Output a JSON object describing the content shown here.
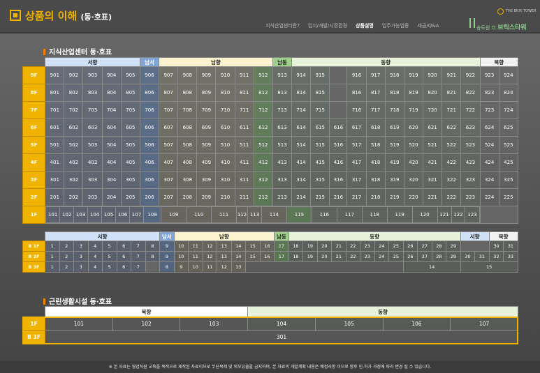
{
  "header": {
    "title": "상품의 이해",
    "subtitle": "(동·호표)",
    "nav": [
      "지식산업센터란?",
      "입지/개발/시장환경",
      "상품설명",
      "입주가능업종",
      "세금/Q&A"
    ],
    "nav_active": 2,
    "logo_top": "THE BRIX TOWER",
    "logo_prefix": "송도원 더",
    "logo_name": "브릭스타워"
  },
  "section1": {
    "title": "지식산업센터 동·호표",
    "directions": [
      "서향",
      "남서",
      "남향",
      "남동",
      "동향",
      "북향"
    ],
    "floors": [
      {
        "label": "9F",
        "units": [
          "901",
          "902",
          "903",
          "904",
          "905",
          "906",
          "907",
          "908",
          "909",
          "910",
          "911",
          "912",
          "913",
          "914",
          "915",
          "",
          "916",
          "917",
          "918",
          "919",
          "920",
          "921",
          "922",
          "923",
          "924"
        ]
      },
      {
        "label": "8F",
        "units": [
          "801",
          "802",
          "803",
          "804",
          "805",
          "806",
          "807",
          "808",
          "809",
          "810",
          "811",
          "812",
          "813",
          "814",
          "815",
          "",
          "816",
          "817",
          "818",
          "819",
          "820",
          "821",
          "822",
          "823",
          "824"
        ]
      },
      {
        "label": "7F",
        "units": [
          "701",
          "702",
          "703",
          "704",
          "705",
          "706",
          "707",
          "708",
          "709",
          "710",
          "711",
          "712",
          "713",
          "714",
          "715",
          "",
          "716",
          "717",
          "718",
          "719",
          "720",
          "721",
          "722",
          "723",
          "724"
        ]
      },
      {
        "label": "6F",
        "units": [
          "601",
          "602",
          "603",
          "604",
          "605",
          "606",
          "607",
          "608",
          "609",
          "610",
          "611",
          "612",
          "613",
          "614",
          "615",
          "616",
          "617",
          "618",
          "619",
          "620",
          "621",
          "622",
          "623",
          "624",
          "625"
        ]
      },
      {
        "label": "5F",
        "units": [
          "501",
          "502",
          "503",
          "504",
          "505",
          "506",
          "507",
          "508",
          "509",
          "510",
          "511",
          "512",
          "513",
          "514",
          "515",
          "516",
          "517",
          "518",
          "519",
          "520",
          "521",
          "522",
          "523",
          "524",
          "525"
        ]
      },
      {
        "label": "4F",
        "units": [
          "401",
          "402",
          "403",
          "404",
          "405",
          "406",
          "407",
          "408",
          "409",
          "410",
          "411",
          "412",
          "413",
          "414",
          "415",
          "416",
          "417",
          "418",
          "419",
          "420",
          "421",
          "422",
          "423",
          "424",
          "425"
        ]
      },
      {
        "label": "3F",
        "units": [
          "301",
          "302",
          "303",
          "304",
          "305",
          "306",
          "307",
          "308",
          "309",
          "310",
          "311",
          "312",
          "313",
          "314",
          "315",
          "316",
          "317",
          "318",
          "319",
          "320",
          "321",
          "322",
          "323",
          "324",
          "325"
        ]
      },
      {
        "label": "2F",
        "units": [
          "201",
          "202",
          "203",
          "204",
          "205",
          "206",
          "207",
          "208",
          "209",
          "210",
          "211",
          "212",
          "213",
          "214",
          "215",
          "216",
          "217",
          "218",
          "219",
          "220",
          "221",
          "222",
          "223",
          "224",
          "225"
        ]
      }
    ],
    "floor1": {
      "label": "1F",
      "units": [
        "101",
        "102",
        "103",
        "104",
        "105",
        "106",
        "107",
        "108",
        "109",
        "110",
        "111",
        "112",
        "113",
        "114",
        "115",
        "116",
        "117",
        "118",
        "119",
        "120",
        "121",
        "122",
        "123"
      ]
    }
  },
  "basement": {
    "directions": [
      "서향",
      "남서",
      "남향",
      "남동",
      "동향",
      "서향",
      "북향"
    ],
    "rows": [
      {
        "label": "B 1F",
        "units": [
          "1",
          "2",
          "3",
          "4",
          "5",
          "6",
          "7",
          "8",
          "9",
          "10",
          "11",
          "12",
          "13",
          "14",
          "15",
          "16",
          "17",
          "18",
          "19",
          "20",
          "21",
          "22",
          "23",
          "24",
          "25",
          "26",
          "27",
          "28",
          "29",
          "",
          "30",
          "31"
        ]
      },
      {
        "label": "B 2F",
        "units": [
          "1",
          "2",
          "3",
          "4",
          "5",
          "6",
          "7",
          "8",
          "9",
          "10",
          "11",
          "12",
          "13",
          "14",
          "15",
          "16",
          "17",
          "18",
          "19",
          "20",
          "21",
          "22",
          "23",
          "24",
          "25",
          "26",
          "27",
          "28",
          "29",
          "30",
          "31",
          "32",
          "33"
        ]
      },
      {
        "label": "B 3F",
        "units": [
          "1",
          "2",
          "3",
          "4",
          "5",
          "6",
          "7",
          "8",
          "9",
          "10",
          "11",
          "12",
          "13",
          "14",
          "15"
        ]
      }
    ]
  },
  "section2": {
    "title": "근린생활시설 동·호표",
    "directions": [
      "북향",
      "동향"
    ],
    "floor1": {
      "label": "1F",
      "units": [
        "101",
        "102",
        "103",
        "104",
        "105",
        "106",
        "107"
      ]
    },
    "b3": {
      "label": "B 3F",
      "units": [
        "301"
      ]
    }
  },
  "footer": "※ 본 자료는 영업직원 교육을 목적으로 제작된 자료이므로 무단복제 및 외부유출을 금지하며, 본 자료의 개발계획 내용은 예정사항 이므로 향후 인.허가 과정에 따라 변경 될 수 있습니다."
}
